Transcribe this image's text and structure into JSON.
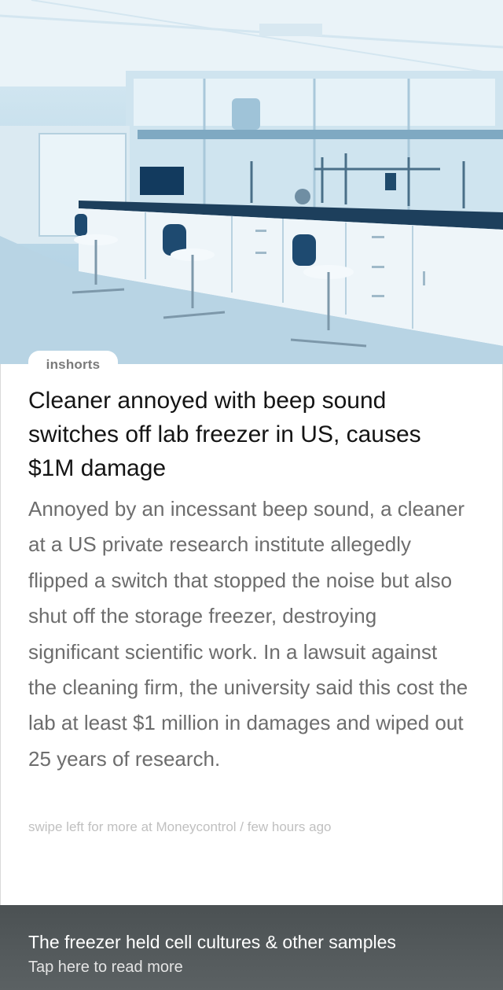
{
  "brand": {
    "name": "inshorts"
  },
  "article": {
    "headline": "Cleaner annoyed with beep sound switches off lab freezer in US, causes $1M damage",
    "body": "Annoyed by an incessant beep sound, a cleaner at a US private research institute allegedly flipped a switch that stopped the noise but also shut off the storage freezer, destroying significant scientific work. In a lawsuit against the cleaning firm, the university said this cost the lab at least $1 million in damages and wiped out 25 years of research.",
    "meta": "swipe left for more at Moneycontrol / few hours ago"
  },
  "footer": {
    "title": "The freezer held cell cultures & other samples",
    "cta": "Tap here to read more"
  },
  "colors": {
    "footer_bg": "#545a5c",
    "headline": "#141414",
    "body": "#6d6d6d",
    "meta": "#c0c0c0"
  },
  "image": {
    "description_icon": "lab-photo"
  }
}
